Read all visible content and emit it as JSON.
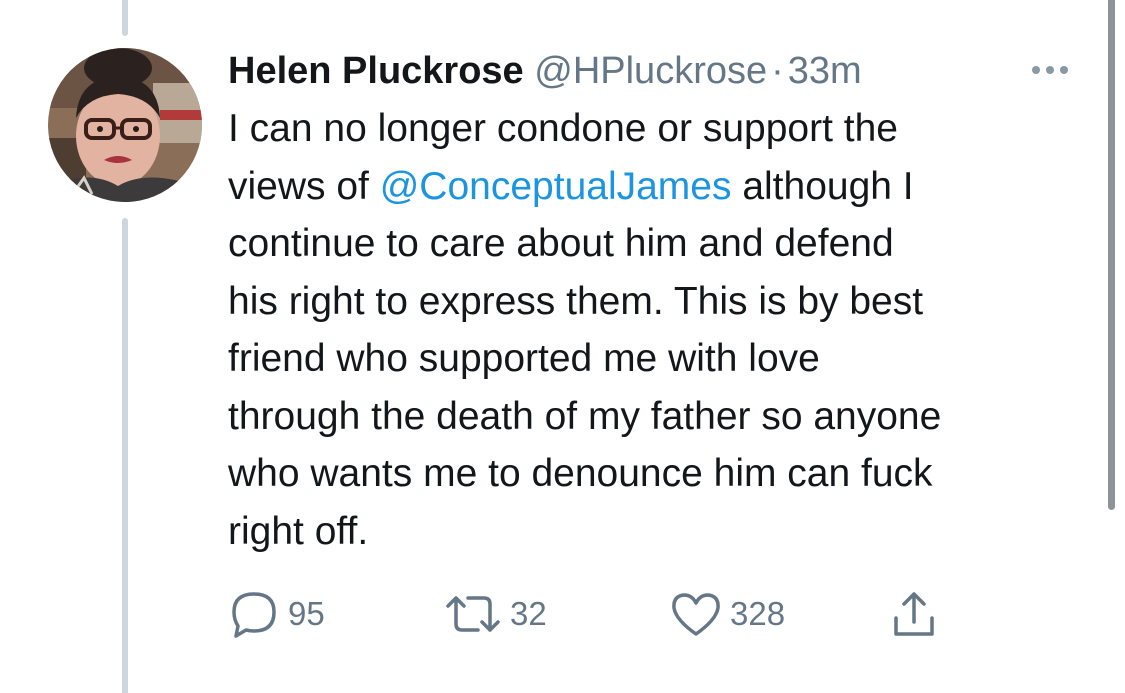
{
  "tweet": {
    "display_name": "Helen Pluckrose",
    "handle": "@HPluckrose",
    "separator": "·",
    "time": "33m",
    "more_icon": "more-horizontal-icon",
    "text_lines": [
      {
        "before": "I can no longer condone or support the"
      },
      {
        "before": "views of ",
        "mention": "@ConceptualJames",
        "after": " although I"
      },
      {
        "before": "continue to care about him and defend"
      },
      {
        "before": "his right to express them. This is by best"
      },
      {
        "before": "friend who supported me with love"
      },
      {
        "before": "through the death of my father so anyone"
      },
      {
        "before": "who wants me to denounce him can fuck"
      },
      {
        "before": "right off."
      }
    ],
    "actions": {
      "reply": {
        "icon": "reply-icon",
        "count": "95"
      },
      "retweet": {
        "icon": "retweet-icon",
        "count": "32"
      },
      "like": {
        "icon": "heart-icon",
        "count": "328"
      },
      "share": {
        "icon": "share-icon"
      }
    }
  },
  "colors": {
    "text": "#14171a",
    "secondary": "#657786",
    "link": "#1b95e0",
    "thread_line": "#ccd6dd"
  }
}
